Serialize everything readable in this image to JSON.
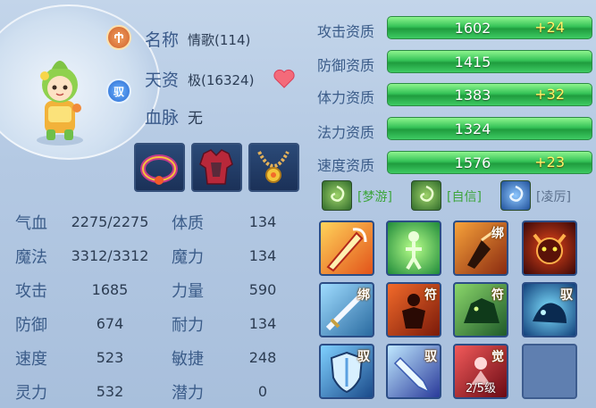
{
  "pet_info": {
    "name_label": "名称",
    "name_value": "情歌(114)",
    "talent_label": "天资",
    "talent_value": "极(16324)",
    "bloodline_label": "血脉",
    "bloodline_value": "无",
    "rank_icon": "rank-icon",
    "tame_badge": "驭"
  },
  "equipment": [
    {
      "icon": "bracelet-icon"
    },
    {
      "icon": "armor-icon"
    },
    {
      "icon": "necklace-icon"
    }
  ],
  "stats": {
    "hp_label": "气血",
    "hp_value": "2275/2275",
    "mp_label": "魔法",
    "mp_value": "3312/3312",
    "attack_label": "攻击",
    "attack_value": "1685",
    "defense_label": "防御",
    "defense_value": "674",
    "speed_label": "速度",
    "speed_value": "523",
    "spirit_label": "灵力",
    "spirit_value": "532",
    "constitution_label": "体质",
    "constitution_value": "134",
    "magic_label": "魔力",
    "magic_value": "134",
    "strength_label": "力量",
    "strength_value": "590",
    "endurance_label": "耐力",
    "endurance_value": "134",
    "agility_label": "敏捷",
    "agility_value": "248",
    "potential_label": "潜力",
    "potential_value": "0"
  },
  "aptitudes": [
    {
      "label": "攻击资质",
      "value": "1602",
      "bonus": "+24"
    },
    {
      "label": "防御资质",
      "value": "1415",
      "bonus": ""
    },
    {
      "label": "体力资质",
      "value": "1383",
      "bonus": "+32"
    },
    {
      "label": "法力资质",
      "value": "1324",
      "bonus": ""
    },
    {
      "label": "速度资质",
      "value": "1576",
      "bonus": "+23"
    }
  ],
  "traits": [
    {
      "label": "[梦游]",
      "color": "#3da53d"
    },
    {
      "label": "[自信]",
      "color": "#3da53d"
    },
    {
      "label": "[凌厉]",
      "color": "#5a6f8c"
    }
  ],
  "skills": [
    {
      "icon": "flame-sword-icon",
      "tag": ""
    },
    {
      "icon": "green-spirit-icon",
      "tag": ""
    },
    {
      "icon": "shadow-strike-icon",
      "tag": "绑"
    },
    {
      "icon": "demon-head-icon",
      "tag": ""
    },
    {
      "icon": "sword-thrust-icon",
      "tag": "绑"
    },
    {
      "icon": "red-fighter-icon",
      "tag": "符"
    },
    {
      "icon": "green-beast-icon",
      "tag": "符"
    },
    {
      "icon": "blue-beast-icon",
      "tag": "驭"
    },
    {
      "icon": "shield-icon",
      "tag": "驭"
    },
    {
      "icon": "ice-crystal-icon",
      "tag": "驭"
    },
    {
      "icon": "red-awaken-icon",
      "tag": "觉",
      "level": "2/5级"
    },
    {
      "icon": "empty-slot",
      "tag": ""
    }
  ]
}
